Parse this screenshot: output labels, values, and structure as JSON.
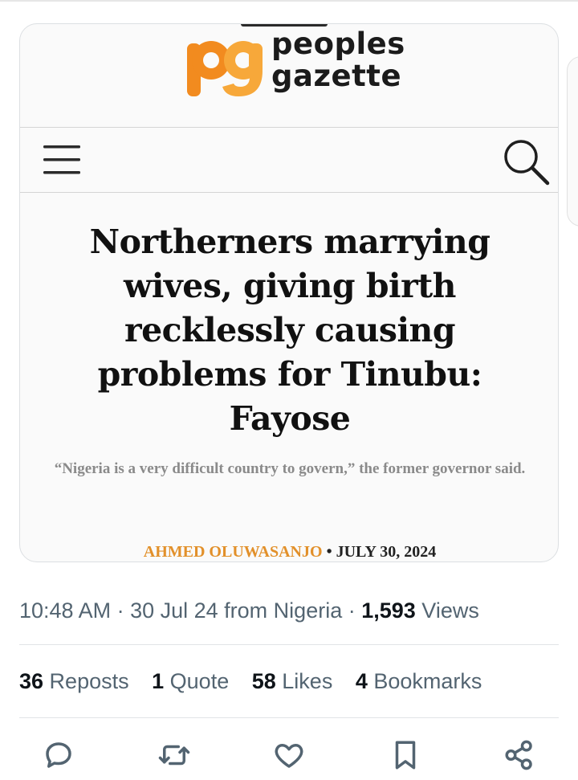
{
  "logo": {
    "mark": "pg",
    "line1": "peoples",
    "line2": "gazette"
  },
  "nav": {
    "menu_icon": "hamburger-menu-icon",
    "search_icon": "search-icon"
  },
  "article": {
    "headline": "Northerners marrying wives, giving birth recklessly causing problems for Tinubu: Fayose",
    "subtitle": "“Nigeria is a very difficult country to govern,” the former governor said.",
    "author": "AHMED OLUWASANJO",
    "separator": " • ",
    "date": "JULY 30, 2024"
  },
  "meta": {
    "time": "10:48 AM",
    "sep1": " · ",
    "date": "30 Jul 24",
    "location": " from Nigeria",
    "sep2": " · ",
    "views_count": "1,593",
    "views_label": " Views"
  },
  "stats": [
    {
      "count": "36",
      "label": " Reposts"
    },
    {
      "count": "1",
      "label": " Quote"
    },
    {
      "count": "58",
      "label": " Likes"
    },
    {
      "count": "4",
      "label": " Bookmarks"
    }
  ],
  "actions": [
    "reply-icon",
    "repost-icon",
    "like-icon",
    "bookmark-icon",
    "share-icon"
  ],
  "colors": {
    "logo_orange": "#f28b1f",
    "author_orange": "#e2902a",
    "icon_gray": "#536471",
    "text_dark": "#0f1419"
  }
}
